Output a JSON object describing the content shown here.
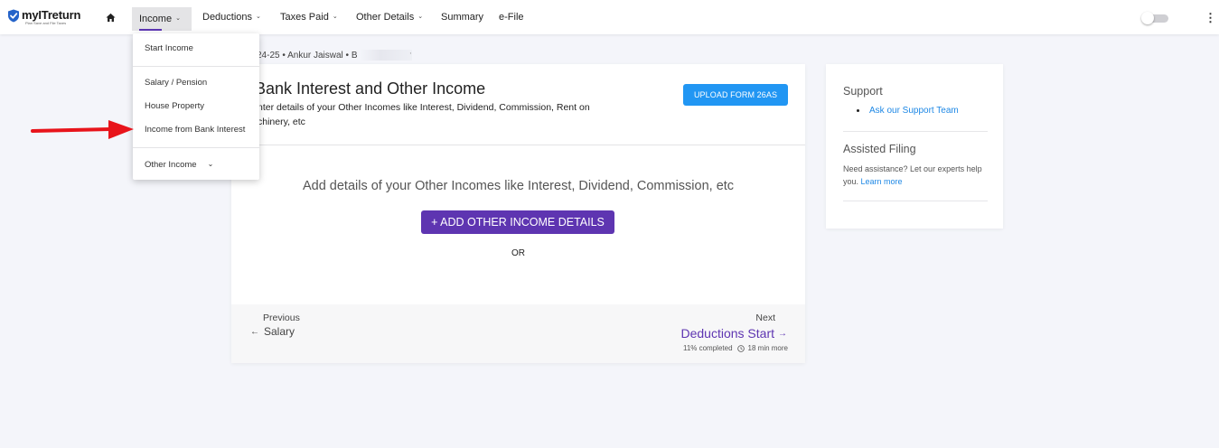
{
  "brand": {
    "name": "myITreturn",
    "tagline": "Plan Save and File Taxes",
    "accent": "#5e35b1",
    "link_color": "#1e88e5",
    "upload_color": "#2196f3",
    "arrow_color": "#e8141b"
  },
  "nav": {
    "items": [
      {
        "label": "Income",
        "active": true
      },
      {
        "label": "Deductions"
      },
      {
        "label": "Taxes Paid"
      },
      {
        "label": "Other Details"
      },
      {
        "label": "Summary"
      },
      {
        "label": "e-File"
      }
    ],
    "icons": [
      "home-icon",
      "theme-toggle",
      "more-vert-icon",
      "chevron-down-icon"
    ]
  },
  "income_menu": {
    "items": [
      {
        "label": "Start Income"
      },
      {
        "label": "Salary / Pension"
      },
      {
        "label": "House Property"
      },
      {
        "label": "Income from Bank Interest"
      },
      {
        "label": "Other Income"
      }
    ]
  },
  "breadcrumb": {
    "text": "24-25 • Ankur Jaiswal • B"
  },
  "main": {
    "title": "Bank Interest and Other Income",
    "description": "nter details of your Other Incomes like Interest, Dividend, Commission, Rent on chinery, etc",
    "upload_button": "UPLOAD FORM 26AS",
    "add_prompt": "Add details of your Other Incomes like Interest, Dividend, Commission, etc",
    "add_button": "+ ADD OTHER INCOME DETAILS",
    "or_text": "OR"
  },
  "footer": {
    "previous_label": "Previous",
    "previous_link": "Salary",
    "next_label": "Next",
    "next_link": "Deductions Start",
    "progress_text": "11% completed",
    "time_text": "18 min more"
  },
  "support": {
    "title": "Support",
    "link": "Ask our Support Team",
    "assisted_title": "Assisted Filing",
    "assisted_desc": "Need assistance? Let our experts help you.",
    "learn_more": "Learn more"
  }
}
